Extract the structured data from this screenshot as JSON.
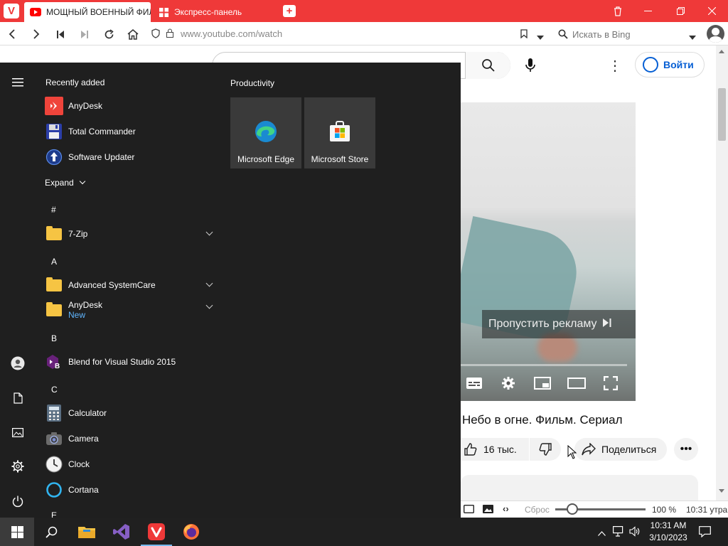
{
  "browser": {
    "tabs": [
      {
        "title": "МОЩНЫЙ ВОЕННЫЙ ФИЛЬ",
        "icon": "youtube-icon"
      },
      {
        "title": "Экспресс-панель",
        "icon": "speed-dial-icon"
      }
    ],
    "url": "www.youtube.com/watch",
    "search_placeholder": "Искать в Bing",
    "accent_color": "#ef3939"
  },
  "youtube": {
    "signin_label": "Войти",
    "skip_ad_label": "Пропустить рекламу",
    "video_title": "Небо в огне. Фильм. Сериал",
    "like_count": "16 тыс.",
    "share_label": "Поделиться"
  },
  "statusbar": {
    "reset_label": "Сброс",
    "zoom": "100 %",
    "time": "10:31 утра",
    "zoom_level": 1.0
  },
  "start_menu": {
    "recent_heading": "Recently added",
    "recent_apps": [
      "AnyDesk",
      "Total Commander",
      "Software Updater"
    ],
    "expand_label": "Expand",
    "letters": {
      "hash": "#",
      "a": "A",
      "b": "B",
      "c": "C",
      "e": "E"
    },
    "apps": {
      "zip": "7-Zip",
      "asc": "Advanced SystemCare",
      "anydesk": "AnyDesk",
      "anydesk_badge": "New",
      "blend": "Blend for Visual Studio 2015",
      "calculator": "Calculator",
      "camera": "Camera",
      "clock": "Clock",
      "cortana": "Cortana"
    },
    "productivity_heading": "Productivity",
    "tiles": [
      "Microsoft Edge",
      "Microsoft Store"
    ]
  },
  "taskbar": {
    "time": "10:31 AM",
    "date": "3/10/2023"
  }
}
